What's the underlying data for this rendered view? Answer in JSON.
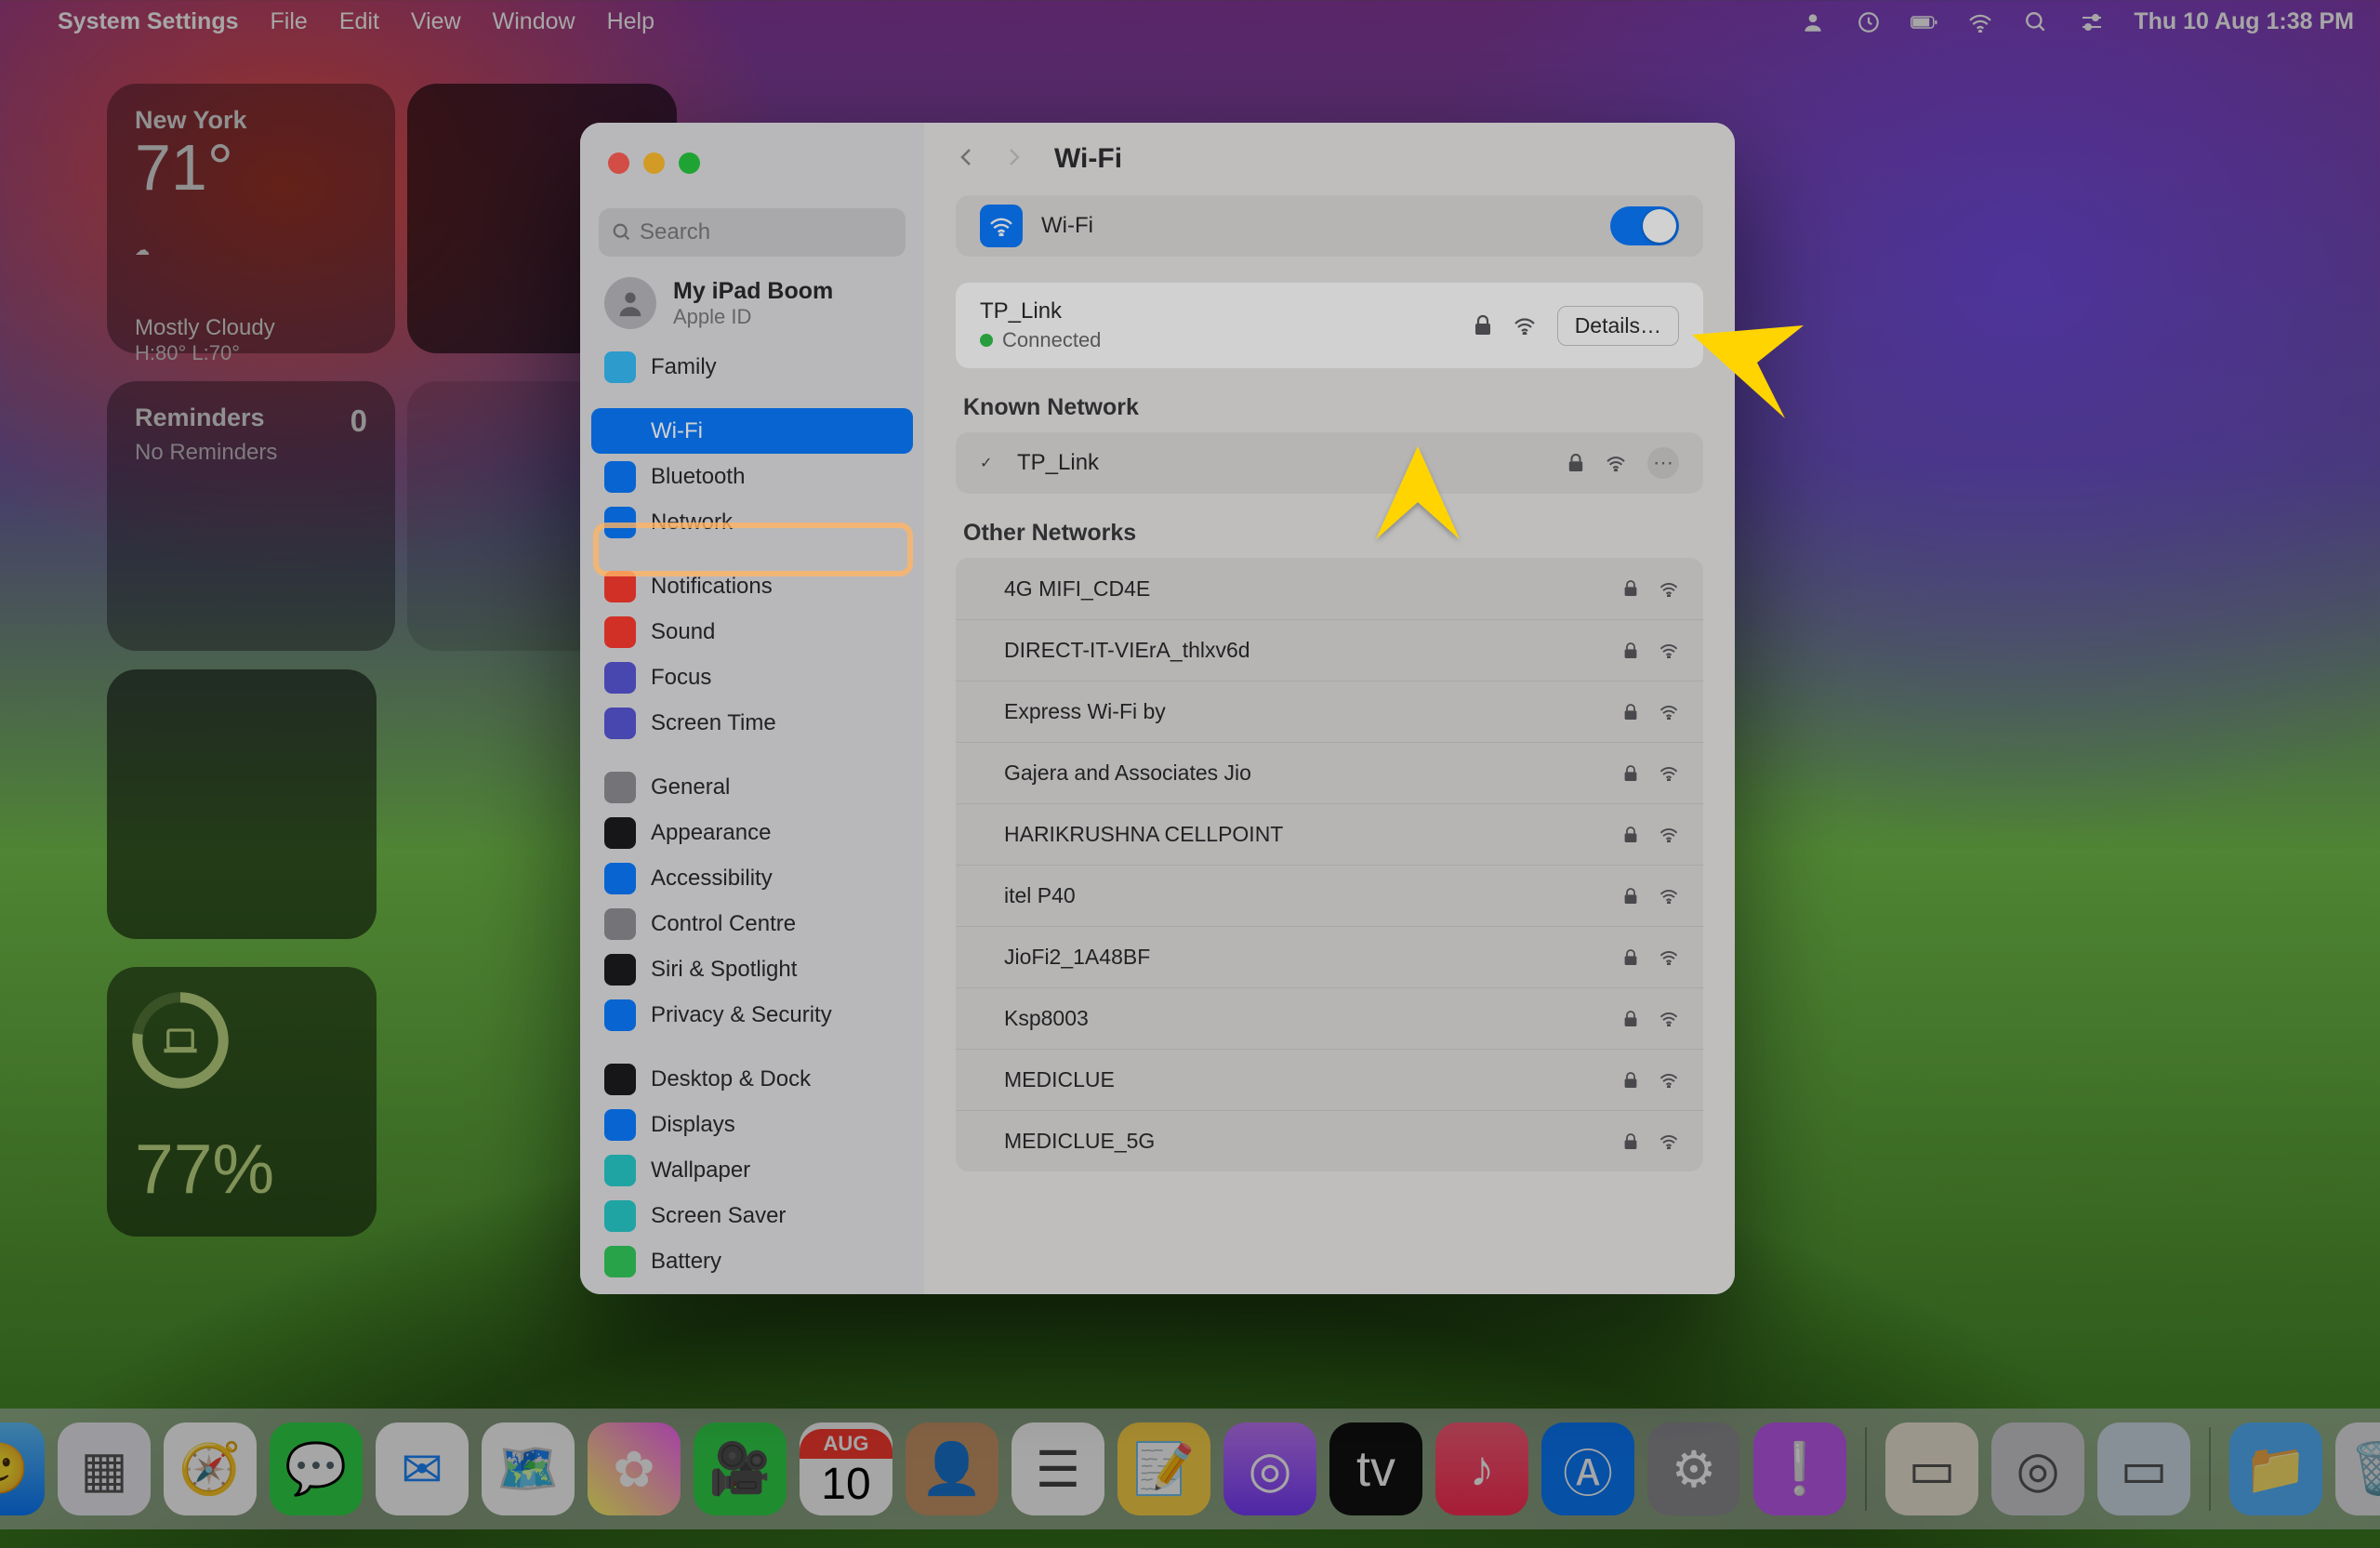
{
  "menubar": {
    "app": "System Settings",
    "menus": [
      "File",
      "Edit",
      "View",
      "Window",
      "Help"
    ],
    "clock": "Thu 10 Aug  1:38 PM"
  },
  "widgets": {
    "weather": {
      "city": "New York",
      "temp": "71°",
      "cond": "Mostly Cloudy",
      "hilo": "H:80° L:70°"
    },
    "reminders": {
      "title": "Reminders",
      "count": "0",
      "none": "No Reminders"
    },
    "battery": {
      "pct": "77%"
    }
  },
  "sidebar": {
    "search_placeholder": "Search",
    "account": {
      "name": "My iPad Boom",
      "sub": "Apple ID"
    },
    "groups": [
      [
        {
          "label": "Family",
          "color": "#37bdf8",
          "name": "family"
        }
      ],
      [
        {
          "label": "Wi-Fi",
          "color": "#0a7bff",
          "name": "wifi",
          "selected": true
        },
        {
          "label": "Bluetooth",
          "color": "#0a7bff",
          "name": "bluetooth"
        },
        {
          "label": "Network",
          "color": "#0a7bff",
          "name": "network"
        }
      ],
      [
        {
          "label": "Notifications",
          "color": "#ff3b30",
          "name": "notifications"
        },
        {
          "label": "Sound",
          "color": "#ff3b30",
          "name": "sound"
        },
        {
          "label": "Focus",
          "color": "#5856d6",
          "name": "focus"
        },
        {
          "label": "Screen Time",
          "color": "#5856d6",
          "name": "screen-time"
        }
      ],
      [
        {
          "label": "General",
          "color": "#8e8e93",
          "name": "general"
        },
        {
          "label": "Appearance",
          "color": "#1c1c1e",
          "name": "appearance"
        },
        {
          "label": "Accessibility",
          "color": "#0a7bff",
          "name": "accessibility"
        },
        {
          "label": "Control Centre",
          "color": "#8e8e93",
          "name": "control-centre"
        },
        {
          "label": "Siri & Spotlight",
          "color": "#1c1c1e",
          "name": "siri-spotlight"
        },
        {
          "label": "Privacy & Security",
          "color": "#0a7bff",
          "name": "privacy-security"
        }
      ],
      [
        {
          "label": "Desktop & Dock",
          "color": "#1c1c1e",
          "name": "desktop-dock"
        },
        {
          "label": "Displays",
          "color": "#0a7bff",
          "name": "displays"
        },
        {
          "label": "Wallpaper",
          "color": "#28c7c7",
          "name": "wallpaper"
        },
        {
          "label": "Screen Saver",
          "color": "#28c7c7",
          "name": "screen-saver"
        },
        {
          "label": "Battery",
          "color": "#33c759",
          "name": "battery"
        }
      ]
    ]
  },
  "main": {
    "title": "Wi-Fi",
    "wifi_label": "Wi-Fi",
    "current": {
      "ssid": "TP_Link",
      "status": "Connected",
      "details": "Details…"
    },
    "known_header": "Known Network",
    "known": [
      {
        "ssid": "TP_Link"
      }
    ],
    "other_header": "Other Networks",
    "other": [
      {
        "ssid": "4G MIFI_CD4E"
      },
      {
        "ssid": "DIRECT-IT-VIErA_thlxv6d"
      },
      {
        "ssid": "Express Wi-Fi by"
      },
      {
        "ssid": "Gajera and Associates Jio"
      },
      {
        "ssid": "HARIKRUSHNA CELLPOINT"
      },
      {
        "ssid": "itel P40"
      },
      {
        "ssid": "JioFi2_1A48BF"
      },
      {
        "ssid": "Ksp8003"
      },
      {
        "ssid": "MEDICLUE"
      },
      {
        "ssid": "MEDICLUE_5G"
      }
    ]
  },
  "dock": {
    "cal": {
      "month": "AUG",
      "day": "10"
    }
  }
}
